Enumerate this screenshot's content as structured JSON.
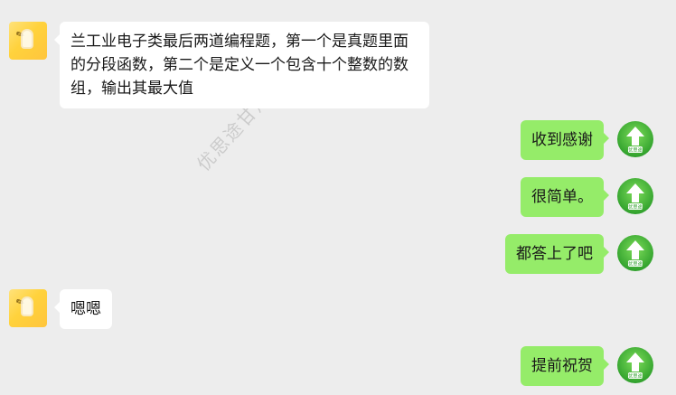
{
  "colors": {
    "background": "#ededed",
    "left_bubble": "#ffffff",
    "right_bubble": "#95ec69",
    "right_avatar_ring": "#2bab3a",
    "right_avatar_fill": "#ffffff"
  },
  "watermark": {
    "text": "优思途甘肃专升本网"
  },
  "avatars": {
    "left": {
      "icon": "cartoon-avatar-icon"
    },
    "right": {
      "icon": "upload-arrow-badge-icon",
      "badge_text": "优思途"
    }
  },
  "messages": [
    {
      "side": "left",
      "text": "兰工业电子类最后两道编程题，第一个是真题里面的分段函数，第二个是定义一个包含十个整数的数组，输出其最大值"
    },
    {
      "side": "right",
      "text": "收到感谢"
    },
    {
      "side": "right",
      "text": "很简单。"
    },
    {
      "side": "right",
      "text": "都答上了吧"
    },
    {
      "side": "left",
      "text": "嗯嗯"
    },
    {
      "side": "right",
      "text": "提前祝贺"
    }
  ]
}
